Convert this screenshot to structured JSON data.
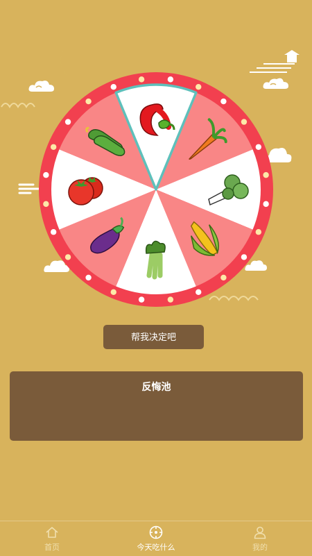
{
  "wheel": {
    "items": [
      {
        "name": "red-chili"
      },
      {
        "name": "carrot"
      },
      {
        "name": "bok-choy"
      },
      {
        "name": "corn"
      },
      {
        "name": "celery"
      },
      {
        "name": "eggplant"
      },
      {
        "name": "tomato"
      },
      {
        "name": "cucumber"
      }
    ],
    "colors": {
      "rim": "#f2404f",
      "pink": "#f98686",
      "white": "#ffffff",
      "highlight": "#5ec0bb"
    }
  },
  "decide_button": {
    "label": "帮我决定吧"
  },
  "regret_pool": {
    "title": "反悔池"
  },
  "tabs": [
    {
      "label": "首页",
      "icon": "home-icon"
    },
    {
      "label": "今天吃什么",
      "icon": "compass-icon"
    },
    {
      "label": "我的",
      "icon": "user-icon"
    }
  ]
}
